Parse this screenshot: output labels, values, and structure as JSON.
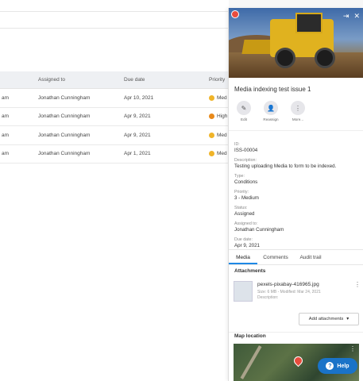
{
  "table": {
    "headers": [
      "",
      "Assigned to",
      "Due date",
      "Priority"
    ],
    "rows": [
      {
        "c0": "am",
        "assigned": "Jonathan Cunningham",
        "due": "Apr 10, 2021",
        "priority": "Med",
        "color": "#f0b429"
      },
      {
        "c0": "am",
        "assigned": "Jonathan Cunningham",
        "due": "Apr 9, 2021",
        "priority": "High",
        "color": "#e8891a"
      },
      {
        "c0": "am",
        "assigned": "Jonathan Cunningham",
        "due": "Apr 9, 2021",
        "priority": "Med",
        "color": "#f0b429"
      },
      {
        "c0": "am",
        "assigned": "Jonathan Cunningham",
        "due": "Apr 1, 2021",
        "priority": "Med",
        "color": "#f0b429"
      }
    ]
  },
  "panel": {
    "title": "Media indexing test issue 1",
    "actions": [
      {
        "label": "Edit",
        "icon": "pencil-icon"
      },
      {
        "label": "Reassign",
        "icon": "user-icon"
      },
      {
        "label": "More...",
        "icon": "more-icon"
      }
    ],
    "fields": [
      {
        "label": "ID:",
        "value": "ISS-00004"
      },
      {
        "label": "Description:",
        "value": "Testing uploading Media to form to be indexed."
      },
      {
        "label": "Type:",
        "value": "Conditions"
      },
      {
        "label": "Priority:",
        "value": "3 - Medium"
      },
      {
        "label": "Status:",
        "value": "Assigned"
      },
      {
        "label": "Assigned to:",
        "value": "Jonathan Cunningham"
      },
      {
        "label": "Due date:",
        "value": "Apr 9, 2021"
      }
    ],
    "tabs": [
      "Media",
      "Comments",
      "Audit trail"
    ],
    "attachments_heading": "Attachments",
    "attachment": {
      "name": "pexels-pixabay-416965.jpg",
      "meta": "Size: 6 MB - Modified: Mar 24, 2021",
      "description": "Description:"
    },
    "add_attachments": "Add attachments",
    "map_heading": "Map location",
    "help": "Help"
  }
}
